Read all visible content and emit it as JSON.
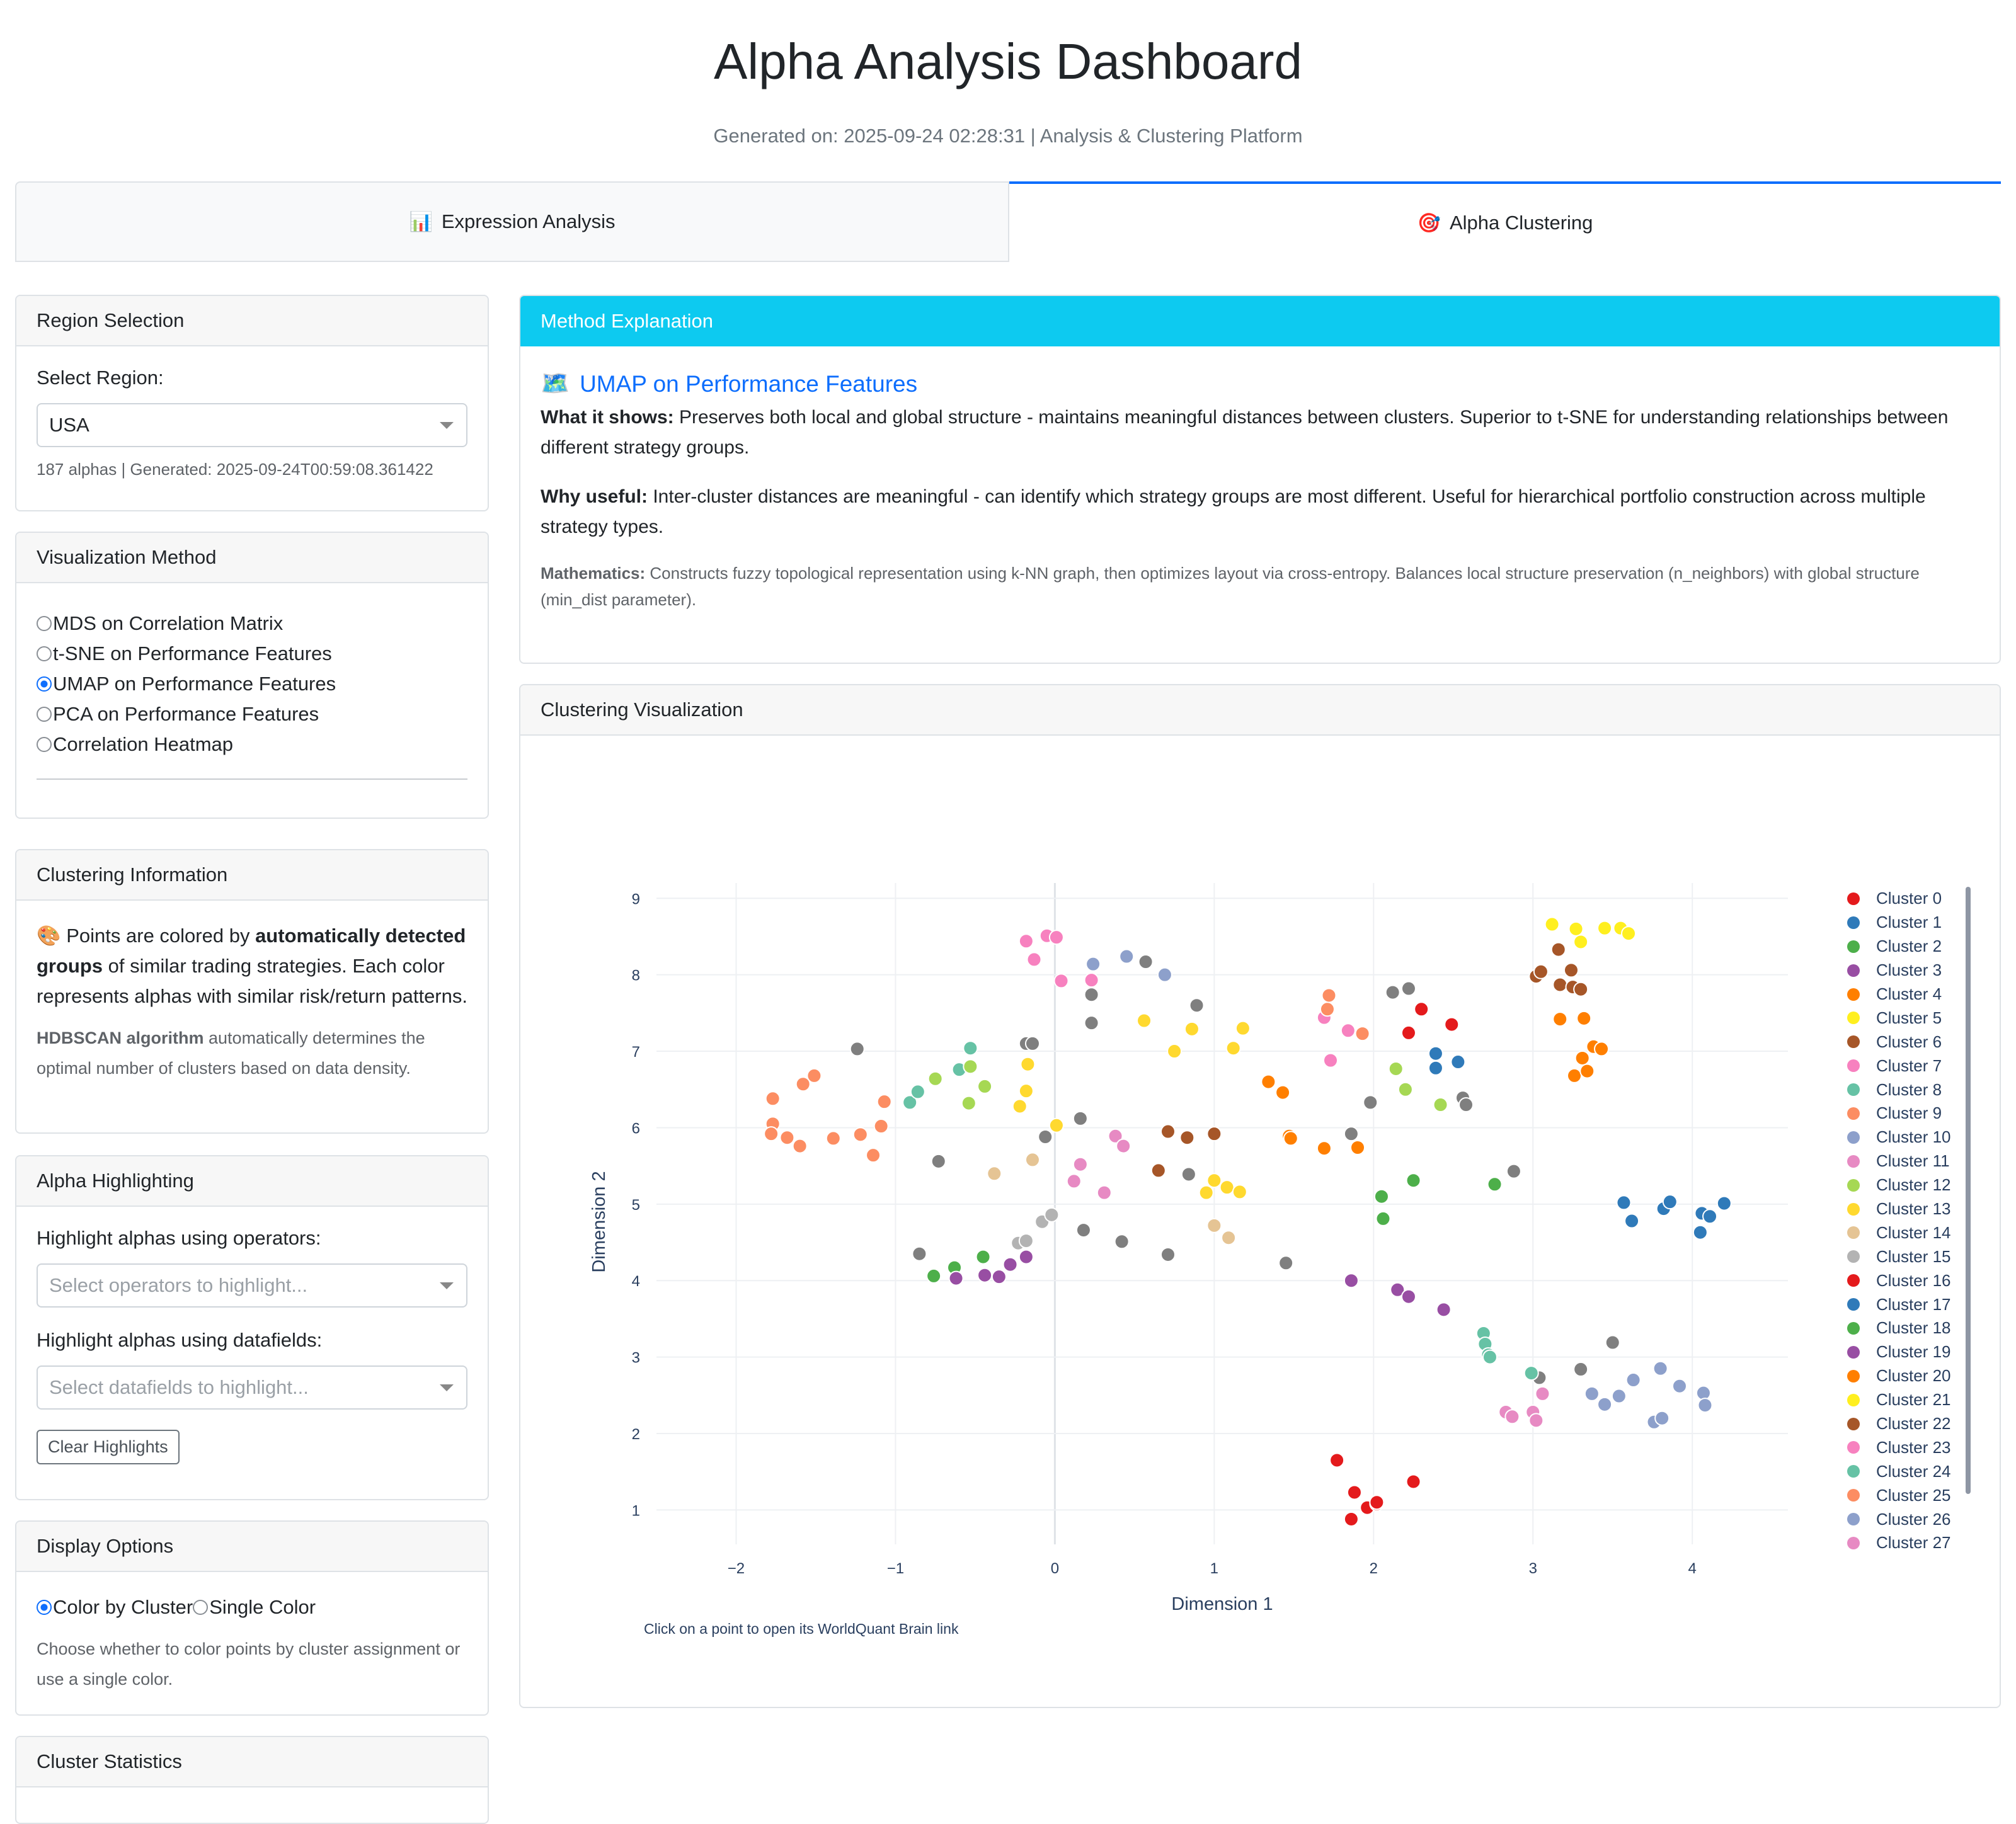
{
  "header": {
    "title": "Alpha Analysis Dashboard",
    "subtitle": "Generated on: 2025-09-24 02:28:31 | Analysis & Clustering Platform"
  },
  "tabs": [
    {
      "icon": "📊",
      "label": "Expression Analysis",
      "active": false
    },
    {
      "icon": "🎯",
      "label": "Alpha Clustering",
      "active": true
    }
  ],
  "region": {
    "header": "Region Selection",
    "label": "Select Region:",
    "selected": "USA",
    "info": "187 alphas | Generated: 2025-09-24T00:59:08.361422"
  },
  "viz_method": {
    "header": "Visualization Method",
    "options": [
      {
        "label": "MDS on Correlation Matrix",
        "selected": false
      },
      {
        "label": "t-SNE on Performance Features",
        "selected": false
      },
      {
        "label": "UMAP on Performance Features",
        "selected": true
      },
      {
        "label": "PCA on Performance Features",
        "selected": false
      },
      {
        "label": "Correlation Heatmap",
        "selected": false
      }
    ]
  },
  "cluster_info": {
    "header": "Clustering Information",
    "icon": "🎨",
    "text_pre": "Points are colored by ",
    "text_bold": "automatically detected groups",
    "text_post": " of similar trading strategies. Each color represents alphas with similar risk/return patterns.",
    "algo_bold": "HDBSCAN algorithm",
    "algo_text": " automatically determines the optimal number of clusters based on data density."
  },
  "highlight": {
    "header": "Alpha Highlighting",
    "operators_label": "Highlight alphas using operators:",
    "operators_placeholder": "Select operators to highlight...",
    "datafields_label": "Highlight alphas using datafields:",
    "datafields_placeholder": "Select datafields to highlight...",
    "clear_button": "Clear Highlights"
  },
  "display": {
    "header": "Display Options",
    "options": [
      {
        "label": "Color by Cluster",
        "selected": true
      },
      {
        "label": "Single Color",
        "selected": false
      }
    ],
    "help": "Choose whether to color points by cluster assignment or use a single color."
  },
  "stats": {
    "header": "Cluster Statistics"
  },
  "method": {
    "header": "Method Explanation",
    "icon": "🗺️",
    "title": "UMAP on Performance Features",
    "shows_label": "What it shows:",
    "shows_text": " Preserves both local and global structure - maintains meaningful distances between clusters. Superior to t-SNE for understanding relationships between different strategy groups.",
    "useful_label": "Why useful:",
    "useful_text": " Inter-cluster distances are meaningful - can identify which strategy groups are most different. Useful for hierarchical portfolio construction across multiple strategy types.",
    "math_label": "Mathematics:",
    "math_text": " Constructs fuzzy topological representation using k-NN graph, then optimizes layout via cross-entropy. Balances local structure preservation (n_neighbors) with global structure (min_dist parameter)."
  },
  "viz": {
    "header": "Clustering Visualization",
    "footnote": "Click on a point to open its WorldQuant Brain link"
  },
  "chart_data": {
    "type": "scatter",
    "xlabel": "Dimension 1",
    "ylabel": "Dimension 2",
    "xlim": [
      -2.5,
      4.6
    ],
    "ylim": [
      0.55,
      9.2
    ],
    "xticks": [
      -2,
      -1,
      0,
      1,
      2,
      3,
      4
    ],
    "yticks": [
      1,
      2,
      3,
      4,
      5,
      6,
      7,
      8,
      9
    ],
    "xtick_labels": [
      "−2",
      "−1",
      "0",
      "1",
      "2",
      "3",
      "4"
    ],
    "ytick_labels": [
      "1",
      "2",
      "3",
      "4",
      "5",
      "6",
      "7",
      "8",
      "9"
    ],
    "grid": true,
    "legend": "right",
    "noise_color": "#7f7f7f",
    "noise_points": [
      [
        -1.24,
        7.03
      ],
      [
        -0.73,
        5.56
      ],
      [
        -0.85,
        4.35
      ],
      [
        -0.18,
        7.1
      ],
      [
        -0.14,
        7.1
      ],
      [
        -0.06,
        5.88
      ],
      [
        0.16,
        6.12
      ],
      [
        0.23,
        7.74
      ],
      [
        0.23,
        7.37
      ],
      [
        0.18,
        4.66
      ],
      [
        0.42,
        4.51
      ],
      [
        0.57,
        8.17
      ],
      [
        0.71,
        4.34
      ],
      [
        0.84,
        5.39
      ],
      [
        0.89,
        7.6
      ],
      [
        1.45,
        4.23
      ],
      [
        1.86,
        5.92
      ],
      [
        1.98,
        6.33
      ],
      [
        2.12,
        7.77
      ],
      [
        2.22,
        7.82
      ],
      [
        2.56,
        6.39
      ],
      [
        2.58,
        6.3
      ],
      [
        2.88,
        5.43
      ],
      [
        3.04,
        2.73
      ],
      [
        3.3,
        2.84
      ],
      [
        3.5,
        3.19
      ]
    ],
    "series": [
      {
        "name": "Cluster 0",
        "color": "#e41a1c",
        "points": [
          [
            1.77,
            1.65
          ],
          [
            1.86,
            0.88
          ],
          [
            1.88,
            1.23
          ],
          [
            1.96,
            1.03
          ],
          [
            2.02,
            1.08
          ],
          [
            2.02,
            1.1
          ],
          [
            2.25,
            1.37
          ]
        ]
      },
      {
        "name": "Cluster 1",
        "color": "#2f7ab9",
        "points": [
          [
            3.57,
            5.02
          ],
          [
            3.62,
            4.78
          ],
          [
            3.82,
            4.94
          ],
          [
            3.86,
            5.03
          ],
          [
            4.05,
            4.63
          ],
          [
            4.06,
            4.88
          ],
          [
            4.11,
            4.84
          ],
          [
            4.2,
            5.01
          ]
        ]
      },
      {
        "name": "Cluster 2",
        "color": "#4daf4a",
        "points": [
          [
            -0.76,
            4.06
          ],
          [
            -0.63,
            4.17
          ],
          [
            -0.45,
            4.31
          ],
          [
            2.05,
            5.1
          ],
          [
            2.06,
            4.81
          ],
          [
            2.25,
            5.31
          ],
          [
            2.76,
            5.26
          ]
        ]
      },
      {
        "name": "Cluster 3",
        "color": "#984ea3",
        "points": [
          [
            -0.62,
            4.03
          ],
          [
            -0.44,
            4.07
          ],
          [
            -0.35,
            4.05
          ],
          [
            -0.28,
            4.21
          ],
          [
            -0.18,
            4.31
          ],
          [
            1.86,
            4.0
          ],
          [
            2.15,
            3.88
          ],
          [
            2.22,
            3.79
          ],
          [
            2.44,
            3.62
          ]
        ]
      },
      {
        "name": "Cluster 4",
        "color": "#ff7f00",
        "points": [
          [
            1.34,
            6.6
          ],
          [
            1.43,
            6.46
          ],
          [
            1.47,
            5.89
          ],
          [
            1.48,
            5.86
          ],
          [
            1.69,
            5.73
          ],
          [
            1.9,
            5.74
          ],
          [
            3.17,
            7.42
          ],
          [
            3.26,
            6.68
          ],
          [
            3.31,
            6.91
          ],
          [
            3.32,
            7.43
          ],
          [
            3.34,
            6.74
          ],
          [
            3.38,
            7.06
          ],
          [
            3.43,
            7.03
          ]
        ]
      },
      {
        "name": "Cluster 5",
        "color": "#ffef1f",
        "points": [
          [
            3.12,
            8.66
          ],
          [
            3.27,
            8.6
          ],
          [
            3.3,
            8.43
          ],
          [
            3.45,
            8.61
          ],
          [
            3.55,
            8.61
          ],
          [
            3.6,
            8.54
          ]
        ]
      },
      {
        "name": "Cluster 6",
        "color": "#a65628",
        "points": [
          [
            0.65,
            5.44
          ],
          [
            0.71,
            5.95
          ],
          [
            0.83,
            5.87
          ],
          [
            1.0,
            5.92
          ],
          [
            3.02,
            7.98
          ],
          [
            3.05,
            8.04
          ],
          [
            3.16,
            8.33
          ],
          [
            3.17,
            7.87
          ],
          [
            3.24,
            8.06
          ],
          [
            3.25,
            7.84
          ],
          [
            3.3,
            7.81
          ]
        ]
      },
      {
        "name": "Cluster 7",
        "color": "#f781bf",
        "points": [
          [
            -0.18,
            8.44
          ],
          [
            -0.13,
            8.2
          ],
          [
            -0.05,
            8.51
          ],
          [
            0.01,
            8.49
          ],
          [
            0.04,
            7.92
          ],
          [
            0.23,
            7.93
          ],
          [
            1.69,
            7.44
          ],
          [
            1.73,
            6.88
          ],
          [
            1.84,
            7.27
          ]
        ]
      },
      {
        "name": "Cluster 8",
        "color": "#66c2a5",
        "points": [
          [
            -0.91,
            6.33
          ],
          [
            -0.86,
            6.47
          ],
          [
            -0.6,
            6.76
          ],
          [
            -0.53,
            7.04
          ],
          [
            2.69,
            3.31
          ],
          [
            2.7,
            3.17
          ],
          [
            2.72,
            3.03
          ],
          [
            2.73,
            3.0
          ],
          [
            2.99,
            2.79
          ]
        ]
      },
      {
        "name": "Cluster 9",
        "color": "#fc8d62",
        "points": [
          [
            -1.77,
            6.38
          ],
          [
            -1.77,
            6.05
          ],
          [
            -1.78,
            5.92
          ],
          [
            -1.68,
            5.87
          ],
          [
            -1.6,
            5.76
          ],
          [
            -1.58,
            6.57
          ],
          [
            -1.51,
            6.68
          ],
          [
            -1.39,
            5.86
          ],
          [
            -1.22,
            5.91
          ],
          [
            -1.14,
            5.64
          ],
          [
            -1.09,
            6.02
          ],
          [
            -1.07,
            6.34
          ],
          [
            1.71,
            7.55
          ],
          [
            1.72,
            7.73
          ],
          [
            1.93,
            7.23
          ]
        ]
      },
      {
        "name": "Cluster 10",
        "color": "#8da0cb",
        "points": [
          [
            0.24,
            8.14
          ],
          [
            0.45,
            8.24
          ],
          [
            0.69,
            8.0
          ],
          [
            3.37,
            2.52
          ],
          [
            3.45,
            2.38
          ],
          [
            3.54,
            2.49
          ],
          [
            3.63,
            2.7
          ],
          [
            3.76,
            2.15
          ],
          [
            3.8,
            2.85
          ],
          [
            3.81,
            2.2
          ],
          [
            3.92,
            2.62
          ],
          [
            4.07,
            2.53
          ],
          [
            4.08,
            2.37
          ]
        ]
      },
      {
        "name": "Cluster 11",
        "color": "#e78ac3",
        "points": [
          [
            0.12,
            5.3
          ],
          [
            0.16,
            5.52
          ],
          [
            0.31,
            5.15
          ],
          [
            0.38,
            5.89
          ],
          [
            0.43,
            5.76
          ],
          [
            2.83,
            2.28
          ],
          [
            2.87,
            2.22
          ],
          [
            3.0,
            2.28
          ],
          [
            3.02,
            2.17
          ],
          [
            3.06,
            2.52
          ]
        ]
      },
      {
        "name": "Cluster 12",
        "color": "#a6d854",
        "points": [
          [
            -0.75,
            6.64
          ],
          [
            -0.54,
            6.32
          ],
          [
            -0.53,
            6.8
          ],
          [
            -0.44,
            6.54
          ],
          [
            2.14,
            6.77
          ],
          [
            2.2,
            6.5
          ],
          [
            2.42,
            6.3
          ]
        ]
      },
      {
        "name": "Cluster 13",
        "color": "#ffd92f",
        "points": [
          [
            -0.22,
            6.28
          ],
          [
            -0.18,
            6.48
          ],
          [
            -0.17,
            6.83
          ],
          [
            0.01,
            6.03
          ],
          [
            0.56,
            7.4
          ],
          [
            0.75,
            7.0
          ],
          [
            0.86,
            7.29
          ],
          [
            0.95,
            5.15
          ],
          [
            1.0,
            5.31
          ],
          [
            1.08,
            5.22
          ],
          [
            1.12,
            7.04
          ],
          [
            1.16,
            5.16
          ],
          [
            1.18,
            7.3
          ]
        ]
      },
      {
        "name": "Cluster 14",
        "color": "#e5c494",
        "points": [
          [
            -0.38,
            5.4
          ],
          [
            -0.14,
            5.58
          ],
          [
            1.0,
            4.72
          ],
          [
            1.09,
            4.56
          ]
        ]
      },
      {
        "name": "Cluster 15",
        "color": "#b3b3b3",
        "points": [
          [
            -0.23,
            4.49
          ],
          [
            -0.18,
            4.52
          ],
          [
            -0.08,
            4.77
          ],
          [
            -0.02,
            4.86
          ]
        ]
      },
      {
        "name": "Cluster 16",
        "color": "#e41a1c",
        "points": [
          [
            2.22,
            7.24
          ],
          [
            2.3,
            7.55
          ],
          [
            2.49,
            7.35
          ]
        ]
      },
      {
        "name": "Cluster 17",
        "color": "#2f7ab9",
        "points": [
          [
            2.39,
            6.97
          ],
          [
            2.39,
            6.78
          ],
          [
            2.53,
            6.86
          ]
        ]
      },
      {
        "name": "Cluster 18",
        "color": "#4daf4a",
        "points": []
      },
      {
        "name": "Cluster 19",
        "color": "#984ea3",
        "points": []
      },
      {
        "name": "Cluster 20",
        "color": "#ff7f00",
        "points": []
      },
      {
        "name": "Cluster 21",
        "color": "#ffef1f",
        "points": []
      },
      {
        "name": "Cluster 22",
        "color": "#a65628",
        "points": []
      },
      {
        "name": "Cluster 23",
        "color": "#f781bf",
        "points": []
      },
      {
        "name": "Cluster 24",
        "color": "#66c2a5",
        "points": []
      },
      {
        "name": "Cluster 25",
        "color": "#fc8d62",
        "points": []
      },
      {
        "name": "Cluster 26",
        "color": "#8da0cb",
        "points": []
      },
      {
        "name": "Cluster 27",
        "color": "#e78ac3",
        "points": []
      }
    ]
  }
}
